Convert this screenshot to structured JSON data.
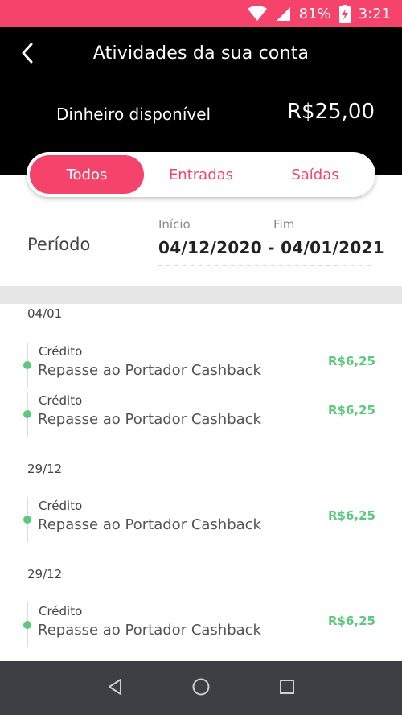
{
  "status_bar": {
    "battery": "81%",
    "time": "3:21"
  },
  "header": {
    "title": "Atividades da sua conta",
    "balance_label": "Dinheiro disponível",
    "balance_value": "R$25,00"
  },
  "tabs": [
    {
      "label": "Todos",
      "active": true
    },
    {
      "label": "Entradas",
      "active": false
    },
    {
      "label": "Saídas",
      "active": false
    }
  ],
  "period": {
    "label": "Período",
    "start_caption": "Início",
    "end_caption": "Fim",
    "range": "04/12/2020 - 04/01/2021"
  },
  "groups": [
    {
      "date": "04/01",
      "items": [
        {
          "type": "Crédito",
          "description": "Repasse ao Portador Cashback",
          "amount": "R$6,25"
        },
        {
          "type": "Crédito",
          "description": "Repasse ao Portador Cashback",
          "amount": "R$6,25"
        }
      ]
    },
    {
      "date": "29/12",
      "items": [
        {
          "type": "Crédito",
          "description": "Repasse ao Portador Cashback",
          "amount": "R$6,25"
        }
      ]
    },
    {
      "date": "29/12",
      "items": [
        {
          "type": "Crédito",
          "description": "Repasse ao Portador Cashback",
          "amount": "R$6,25"
        }
      ]
    }
  ],
  "colors": {
    "accent": "#f5436b",
    "credit": "#5cc97b",
    "header_bg": "#000000",
    "navbar_bg": "#3c3f44"
  },
  "icons": {
    "back": "back-arrow-icon",
    "wifi": "wifi-icon",
    "signal": "signal-icon",
    "battery": "battery-charging-icon",
    "nav_back": "nav-back-icon",
    "nav_home": "nav-home-icon",
    "nav_recents": "nav-recents-icon"
  }
}
